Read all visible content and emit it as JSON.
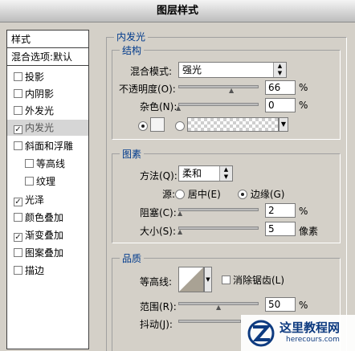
{
  "dialog": {
    "title": "图层样式"
  },
  "styles_panel": {
    "header": "样式",
    "blend_options": "混合选项:默认",
    "items": [
      {
        "label": "投影",
        "checked": false
      },
      {
        "label": "内阴影",
        "checked": false
      },
      {
        "label": "外发光",
        "checked": false
      },
      {
        "label": "内发光",
        "checked": true,
        "selected": true
      },
      {
        "label": "斜面和浮雕",
        "checked": false
      },
      {
        "label": "等高线",
        "checked": false
      },
      {
        "label": "纹理",
        "checked": false
      },
      {
        "label": "光泽",
        "checked": true
      },
      {
        "label": "颜色叠加",
        "checked": false
      },
      {
        "label": "渐变叠加",
        "checked": true
      },
      {
        "label": "图案叠加",
        "checked": false
      },
      {
        "label": "描边",
        "checked": false
      }
    ]
  },
  "inner_glow": {
    "title": "内发光",
    "structure": {
      "title": "结构",
      "blend_mode_label": "混合模式:",
      "blend_mode_value": "强光",
      "opacity_label": "不透明度(O):",
      "opacity_value": "66",
      "opacity_unit": "%",
      "opacity_level": 0.66,
      "noise_label": "杂色(N):",
      "noise_value": "0",
      "noise_unit": "%",
      "noise_level": 0
    },
    "elements": {
      "title": "图素",
      "method_label": "方法(Q):",
      "method_value": "柔和",
      "source_label": "源:",
      "source_center": "居中(E)",
      "source_edge": "边缘(G)",
      "choke_label": "阻塞(C):",
      "choke_value": "2",
      "choke_unit": "%",
      "choke_level": 0.02,
      "size_label": "大小(S):",
      "size_value": "5",
      "size_unit": "像素",
      "size_level": 0.02
    },
    "quality": {
      "title": "品质",
      "contour_label": "等高线:",
      "antialias_label": "消除锯齿(L)",
      "range_label": "范围(R):",
      "range_value": "50",
      "range_unit": "%",
      "range_level": 0.5,
      "jitter_label": "抖动(J):"
    }
  },
  "watermark": {
    "title": "这里教程网",
    "url": "herecours.com"
  },
  "colors": {
    "accent_text": "#003a8c",
    "dialog_bg": "#d4d0c8",
    "watermark": "#0e3b80"
  }
}
